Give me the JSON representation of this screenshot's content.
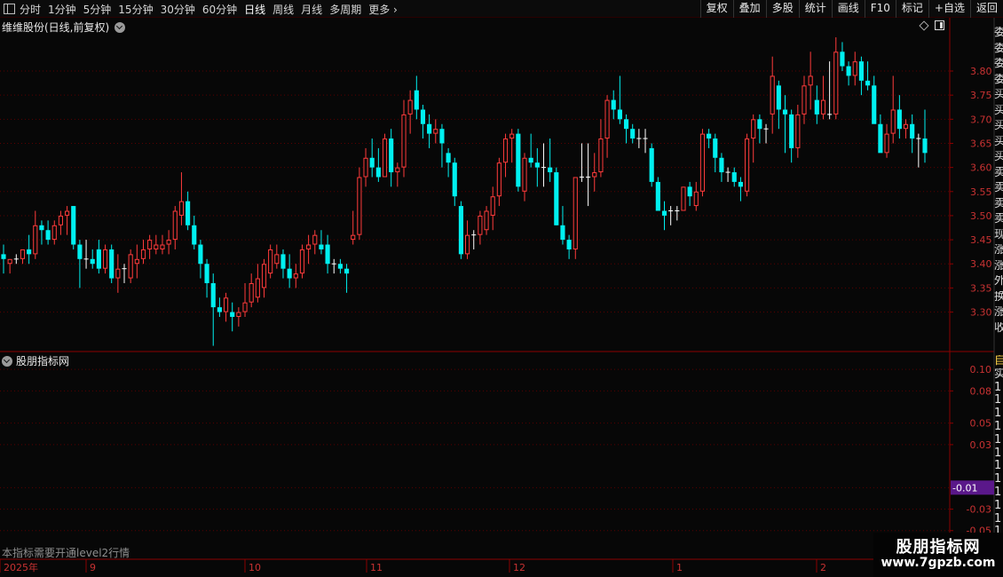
{
  "toolbar": {
    "periods": [
      "分时",
      "1分钟",
      "5分钟",
      "15分钟",
      "30分钟",
      "60分钟",
      "日线",
      "周线",
      "月线",
      "多周期",
      "更多"
    ],
    "active_period": "日线",
    "buttons": [
      "复权",
      "叠加",
      "多股",
      "统计",
      "画线",
      "F10",
      "标记",
      "+自选",
      "返回"
    ]
  },
  "main_title": "维维股份(日线,前复权)",
  "sub_title": "股朋指标网",
  "level2_note": "本指标需要开通level2行情",
  "watermark": {
    "name": "股朋指标网",
    "url": "www.7gpzb.com"
  },
  "colors": {
    "up": "#ff3b3b",
    "down": "#00f0f0",
    "flat": "#ffffff",
    "grid": "#5a0000",
    "axis": "#8b0000",
    "highlight": "#5a188a"
  },
  "right_strip_glyphs": [
    "委",
    "委",
    "委",
    "委",
    "买",
    "买",
    "买",
    "买",
    "买",
    "卖",
    "卖",
    "卖",
    "卖",
    "现",
    "涨",
    "涨",
    "外",
    "换",
    "涨",
    "收"
  ],
  "sub_strip_glyphs": [
    "自",
    "实",
    "1",
    "1",
    "1",
    "1",
    "1",
    "1",
    "1",
    "1",
    "1",
    "1",
    "1",
    "1",
    "1",
    "1",
    "1"
  ],
  "chart_data": {
    "type": "candlestick",
    "price_axis": {
      "ticks": [
        3.3,
        3.35,
        3.4,
        3.45,
        3.5,
        3.55,
        3.6,
        3.65,
        3.7,
        3.75,
        3.8
      ],
      "range": [
        3.22,
        3.87
      ]
    },
    "indicator_axis": {
      "ticks": [
        "0.10",
        "0.08",
        "0.05",
        "0.03",
        "-0.03",
        "-0.05"
      ],
      "current": "-0.01",
      "range": [
        -0.075,
        0.115
      ]
    },
    "time_axis": [
      "2025年",
      "9",
      "10",
      "11",
      "12",
      "1",
      "2"
    ],
    "candles": [
      [
        3.42,
        3.44,
        3.38,
        3.41
      ],
      [
        3.4,
        3.41,
        3.38,
        3.41
      ],
      [
        3.41,
        3.42,
        3.4,
        3.41
      ],
      [
        3.41,
        3.43,
        3.4,
        3.43
      ],
      [
        3.43,
        3.46,
        3.4,
        3.42
      ],
      [
        3.42,
        3.51,
        3.41,
        3.48
      ],
      [
        3.48,
        3.49,
        3.44,
        3.47
      ],
      [
        3.47,
        3.49,
        3.44,
        3.45
      ],
      [
        3.45,
        3.49,
        3.44,
        3.48
      ],
      [
        3.48,
        3.51,
        3.46,
        3.5
      ],
      [
        3.5,
        3.52,
        3.46,
        3.51
      ],
      [
        3.52,
        3.52,
        3.43,
        3.44
      ],
      [
        3.44,
        3.45,
        3.35,
        3.41
      ],
      [
        3.41,
        3.45,
        3.39,
        3.41
      ],
      [
        3.41,
        3.43,
        3.39,
        3.4
      ],
      [
        3.43,
        3.45,
        3.38,
        3.39
      ],
      [
        3.39,
        3.44,
        3.38,
        3.43
      ],
      [
        3.43,
        3.44,
        3.36,
        3.37
      ],
      [
        3.37,
        3.42,
        3.34,
        3.39
      ],
      [
        3.39,
        3.4,
        3.36,
        3.39
      ],
      [
        3.37,
        3.43,
        3.36,
        3.42
      ],
      [
        3.4,
        3.44,
        3.37,
        3.41
      ],
      [
        3.41,
        3.45,
        3.4,
        3.43
      ],
      [
        3.43,
        3.46,
        3.41,
        3.45
      ],
      [
        3.43,
        3.46,
        3.42,
        3.44
      ],
      [
        3.43,
        3.46,
        3.42,
        3.44
      ],
      [
        3.44,
        3.47,
        3.42,
        3.45
      ],
      [
        3.45,
        3.52,
        3.43,
        3.51
      ],
      [
        3.5,
        3.59,
        3.48,
        3.53
      ],
      [
        3.53,
        3.55,
        3.47,
        3.48
      ],
      [
        3.48,
        3.5,
        3.43,
        3.44
      ],
      [
        3.44,
        3.45,
        3.37,
        3.4
      ],
      [
        3.4,
        3.41,
        3.33,
        3.36
      ],
      [
        3.36,
        3.38,
        3.23,
        3.31
      ],
      [
        3.31,
        3.33,
        3.29,
        3.3
      ],
      [
        3.3,
        3.34,
        3.28,
        3.33
      ],
      [
        3.3,
        3.32,
        3.26,
        3.29
      ],
      [
        3.29,
        3.31,
        3.27,
        3.3
      ],
      [
        3.3,
        3.36,
        3.29,
        3.32
      ],
      [
        3.32,
        3.38,
        3.31,
        3.36
      ],
      [
        3.33,
        3.4,
        3.32,
        3.37
      ],
      [
        3.35,
        3.41,
        3.33,
        3.4
      ],
      [
        3.38,
        3.44,
        3.37,
        3.43
      ],
      [
        3.4,
        3.44,
        3.39,
        3.42
      ],
      [
        3.42,
        3.43,
        3.37,
        3.39
      ],
      [
        3.39,
        3.42,
        3.35,
        3.37
      ],
      [
        3.37,
        3.4,
        3.35,
        3.38
      ],
      [
        3.38,
        3.44,
        3.37,
        3.43
      ],
      [
        3.43,
        3.46,
        3.4,
        3.44
      ],
      [
        3.44,
        3.47,
        3.42,
        3.46
      ],
      [
        3.44,
        3.47,
        3.42,
        3.43
      ],
      [
        3.44,
        3.46,
        3.38,
        3.4
      ],
      [
        3.4,
        3.41,
        3.38,
        3.4
      ],
      [
        3.4,
        3.41,
        3.38,
        3.39
      ],
      [
        3.39,
        3.4,
        3.34,
        3.38
      ],
      [
        3.45,
        3.51,
        3.44,
        3.46
      ],
      [
        3.46,
        3.6,
        3.45,
        3.58
      ],
      [
        3.58,
        3.64,
        3.56,
        3.62
      ],
      [
        3.62,
        3.66,
        3.58,
        3.6
      ],
      [
        3.6,
        3.64,
        3.57,
        3.58
      ],
      [
        3.58,
        3.67,
        3.58,
        3.66
      ],
      [
        3.66,
        3.68,
        3.56,
        3.59
      ],
      [
        3.59,
        3.61,
        3.56,
        3.6
      ],
      [
        3.6,
        3.74,
        3.58,
        3.71
      ],
      [
        3.71,
        3.76,
        3.67,
        3.74
      ],
      [
        3.76,
        3.79,
        3.7,
        3.72
      ],
      [
        3.72,
        3.73,
        3.66,
        3.69
      ],
      [
        3.69,
        3.71,
        3.64,
        3.67
      ],
      [
        3.67,
        3.7,
        3.65,
        3.68
      ],
      [
        3.68,
        3.69,
        3.6,
        3.65
      ],
      [
        3.63,
        3.64,
        3.58,
        3.61
      ],
      [
        3.61,
        3.62,
        3.52,
        3.54
      ],
      [
        3.52,
        3.53,
        3.41,
        3.42
      ],
      [
        3.42,
        3.49,
        3.41,
        3.46
      ],
      [
        3.46,
        3.47,
        3.43,
        3.46
      ],
      [
        3.46,
        3.51,
        3.44,
        3.5
      ],
      [
        3.47,
        3.52,
        3.46,
        3.51
      ],
      [
        3.5,
        3.56,
        3.47,
        3.54
      ],
      [
        3.54,
        3.62,
        3.52,
        3.61
      ],
      [
        3.61,
        3.67,
        3.58,
        3.66
      ],
      [
        3.66,
        3.68,
        3.61,
        3.67
      ],
      [
        3.67,
        3.68,
        3.55,
        3.56
      ],
      [
        3.55,
        3.63,
        3.53,
        3.62
      ],
      [
        3.62,
        3.67,
        3.6,
        3.61
      ],
      [
        3.61,
        3.64,
        3.56,
        3.6
      ],
      [
        3.6,
        3.65,
        3.56,
        3.6
      ],
      [
        3.6,
        3.66,
        3.57,
        3.59
      ],
      [
        3.59,
        3.6,
        3.48,
        3.48
      ],
      [
        3.48,
        3.52,
        3.44,
        3.45
      ],
      [
        3.45,
        3.46,
        3.41,
        3.43
      ],
      [
        3.43,
        3.58,
        3.41,
        3.58
      ],
      [
        3.58,
        3.65,
        3.57,
        3.58
      ],
      [
        3.58,
        3.65,
        3.52,
        3.58
      ],
      [
        3.58,
        3.63,
        3.55,
        3.59
      ],
      [
        3.59,
        3.7,
        3.58,
        3.66
      ],
      [
        3.66,
        3.75,
        3.62,
        3.74
      ],
      [
        3.74,
        3.76,
        3.7,
        3.72
      ],
      [
        3.72,
        3.79,
        3.69,
        3.7
      ],
      [
        3.7,
        3.71,
        3.65,
        3.68
      ],
      [
        3.68,
        3.69,
        3.65,
        3.66
      ],
      [
        3.66,
        3.68,
        3.64,
        3.66
      ],
      [
        3.66,
        3.68,
        3.63,
        3.66
      ],
      [
        3.64,
        3.65,
        3.56,
        3.57
      ],
      [
        3.57,
        3.58,
        3.51,
        3.51
      ],
      [
        3.51,
        3.53,
        3.47,
        3.5
      ],
      [
        3.51,
        3.52,
        3.48,
        3.51
      ],
      [
        3.51,
        3.52,
        3.49,
        3.51
      ],
      [
        3.51,
        3.56,
        3.51,
        3.56
      ],
      [
        3.56,
        3.57,
        3.52,
        3.54
      ],
      [
        3.52,
        3.57,
        3.51,
        3.55
      ],
      [
        3.55,
        3.68,
        3.54,
        3.67
      ],
      [
        3.67,
        3.68,
        3.64,
        3.66
      ],
      [
        3.66,
        3.67,
        3.59,
        3.62
      ],
      [
        3.62,
        3.63,
        3.57,
        3.59
      ],
      [
        3.59,
        3.6,
        3.57,
        3.59
      ],
      [
        3.59,
        3.6,
        3.56,
        3.57
      ],
      [
        3.57,
        3.58,
        3.53,
        3.56
      ],
      [
        3.55,
        3.67,
        3.54,
        3.66
      ],
      [
        3.66,
        3.71,
        3.61,
        3.7
      ],
      [
        3.7,
        3.71,
        3.65,
        3.68
      ],
      [
        3.68,
        3.69,
        3.65,
        3.68
      ],
      [
        3.71,
        3.83,
        3.67,
        3.79
      ],
      [
        3.77,
        3.78,
        3.68,
        3.72
      ],
      [
        3.72,
        3.75,
        3.63,
        3.71
      ],
      [
        3.71,
        3.72,
        3.61,
        3.64
      ],
      [
        3.64,
        3.73,
        3.62,
        3.71
      ],
      [
        3.71,
        3.79,
        3.69,
        3.77
      ],
      [
        3.77,
        3.84,
        3.72,
        3.79
      ],
      [
        3.74,
        3.77,
        3.69,
        3.71
      ],
      [
        3.71,
        3.79,
        3.7,
        3.74
      ],
      [
        3.71,
        3.82,
        3.7,
        3.71
      ],
      [
        3.71,
        3.87,
        3.7,
        3.84
      ],
      [
        3.84,
        3.86,
        3.8,
        3.81
      ],
      [
        3.81,
        3.82,
        3.77,
        3.79
      ],
      [
        3.79,
        3.84,
        3.77,
        3.82
      ],
      [
        3.82,
        3.83,
        3.75,
        3.78
      ],
      [
        3.78,
        3.82,
        3.76,
        3.77
      ],
      [
        3.77,
        3.79,
        3.71,
        3.69
      ],
      [
        3.69,
        3.71,
        3.64,
        3.63
      ],
      [
        3.63,
        3.69,
        3.62,
        3.67
      ],
      [
        3.67,
        3.79,
        3.65,
        3.72
      ],
      [
        3.72,
        3.75,
        3.66,
        3.68
      ],
      [
        3.68,
        3.7,
        3.66,
        3.69
      ],
      [
        3.69,
        3.71,
        3.63,
        3.66
      ],
      [
        3.66,
        3.67,
        3.6,
        3.66
      ],
      [
        3.66,
        3.72,
        3.61,
        3.63
      ]
    ]
  }
}
